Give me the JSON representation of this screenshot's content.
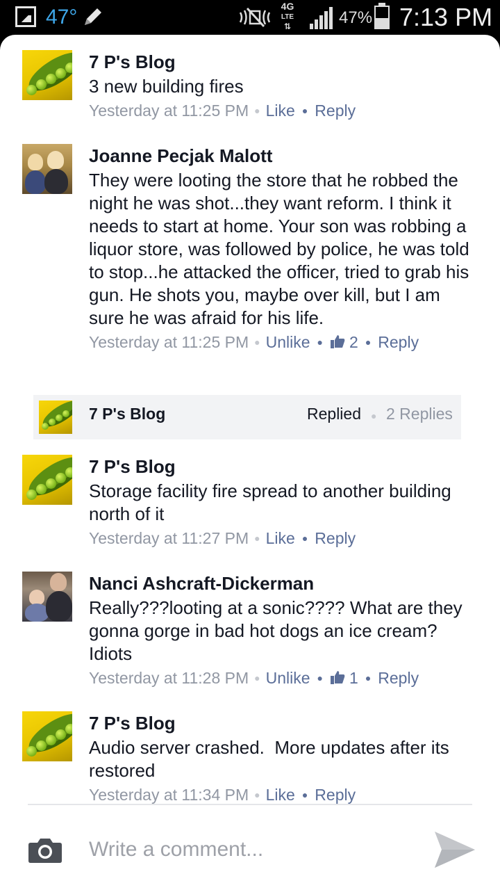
{
  "status_bar": {
    "temperature": "47°",
    "network": "4G",
    "network_sub": "LTE",
    "battery_pct": "47%",
    "battery_level": 0.47,
    "time": "7:13 PM",
    "icons": [
      "gallery-icon",
      "pencil-icon",
      "mute-icon",
      "signal-icon",
      "battery-icon"
    ]
  },
  "comments": [
    {
      "author": "7 P's Blog",
      "text": "3 new building fires",
      "time": "Yesterday at 11:25 PM",
      "like_label": "Like",
      "reply_label": "Reply"
    },
    {
      "author": "Joanne Pecjak Malott",
      "text": "They were looting the store that he robbed the night he was shot...they want reform. I think it needs to start at home. Your son was robbing a liquor store, was followed by police, he was  told to stop...he attacked the officer, tried to grab his gun. He shots you, maybe over kill, but I am sure he was afraid for his life.",
      "time": "Yesterday at 11:25 PM",
      "like_label": "Unlike",
      "like_count": "2",
      "reply_label": "Reply"
    },
    {
      "author": "7 P's Blog",
      "text": "Storage facility fire spread to another building north of it",
      "time": "Yesterday at 11:27 PM",
      "like_label": "Like",
      "reply_label": "Reply"
    },
    {
      "author": "Nanci Ashcraft-Dickerman",
      "text": "Really???looting at a sonic???? What are they gonna gorge in bad hot dogs an ice cream?     Idiots",
      "time": "Yesterday at 11:28 PM",
      "like_label": "Unlike",
      "like_count": "1",
      "reply_label": "Reply"
    },
    {
      "author": "7 P's Blog",
      "text": "Audio server crashed.  More updates after its restored",
      "time": "Yesterday at 11:34 PM",
      "like_label": "Like",
      "reply_label": "Reply"
    }
  ],
  "reply_summary": {
    "author": "7 P's Blog",
    "status": "Replied",
    "count": "2 Replies"
  },
  "composer": {
    "placeholder": "Write a comment..."
  },
  "colors": {
    "link": "#5b6e98",
    "meta": "#9197a3",
    "text": "#141823"
  }
}
